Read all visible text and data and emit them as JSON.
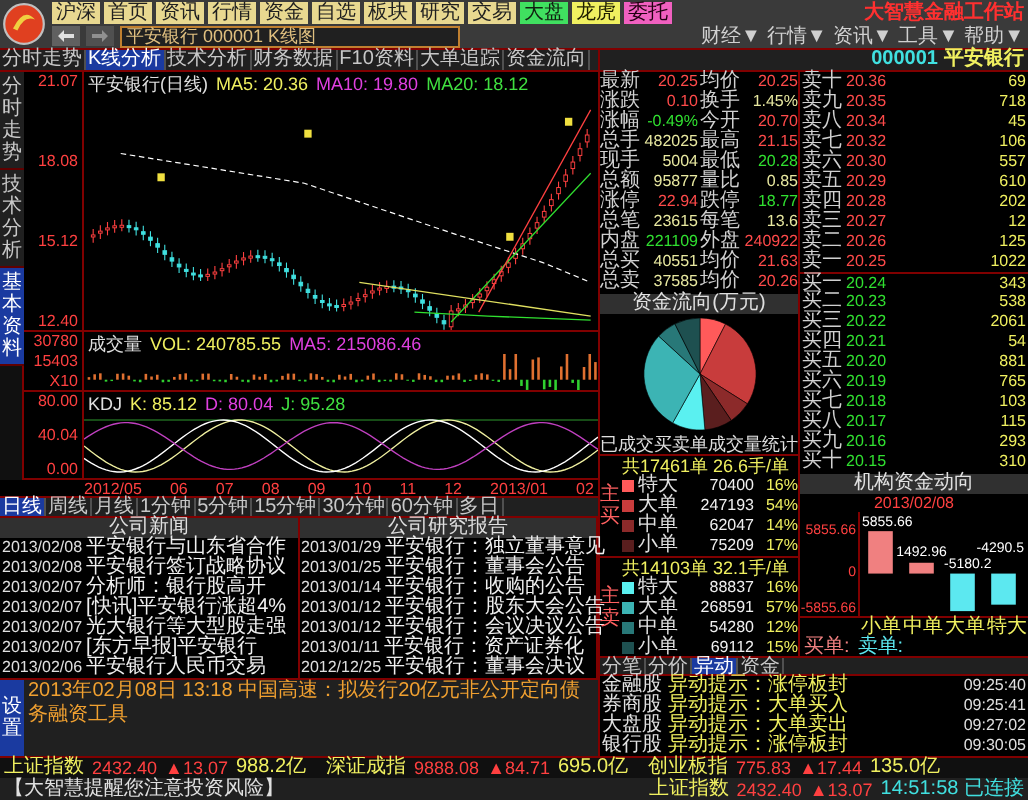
{
  "toolbar": {
    "buttons": [
      {
        "label": "沪深",
        "kind": "normal"
      },
      {
        "label": "首页",
        "kind": "normal"
      },
      {
        "label": "资讯",
        "kind": "normal"
      },
      {
        "label": "行情",
        "kind": "normal"
      },
      {
        "label": "资金",
        "kind": "normal"
      },
      {
        "label": "自选",
        "kind": "normal"
      },
      {
        "label": "板块",
        "kind": "normal"
      },
      {
        "label": "研究",
        "kind": "normal"
      },
      {
        "label": "交易",
        "kind": "normal"
      },
      {
        "label": "大盘",
        "kind": "green"
      },
      {
        "label": "龙虎",
        "kind": "yellow"
      },
      {
        "label": "委托",
        "kind": "pink"
      }
    ],
    "brand": "大智慧金融工作站",
    "address": "平安银行 000001 K线图",
    "menus": [
      "财经▼",
      "行情▼",
      "资讯▼",
      "工具▼",
      "帮助▼"
    ]
  },
  "chart_tabs": [
    {
      "label": "分时走势",
      "selected": false
    },
    {
      "label": "K线分析",
      "selected": true
    },
    {
      "label": "技术分析",
      "selected": false
    },
    {
      "label": "财务数据",
      "selected": false
    },
    {
      "label": "F10资料",
      "selected": false
    },
    {
      "label": "大单追踪",
      "selected": false
    },
    {
      "label": "资金流向",
      "selected": false
    }
  ],
  "side_tabs": [
    {
      "label": "分时走势",
      "selected": false
    },
    {
      "label": "技术分析",
      "selected": false
    },
    {
      "label": "基本资料",
      "selected": true
    }
  ],
  "price_chart": {
    "info": [
      "平安银行(日线)",
      "MA5: 20.36",
      "MA10: 19.80",
      "MA20: 18.12"
    ],
    "ticks": [
      "21.07",
      "18.08",
      "15.12",
      "12.40"
    ]
  },
  "volume_chart": {
    "info": [
      "成交量",
      "VOL: 240785.55",
      "MA5: 215086.46"
    ],
    "ticks": [
      "30780",
      "15403",
      "X10"
    ]
  },
  "oscillator": {
    "info": [
      "KDJ",
      "K: 85.12",
      "D: 80.04",
      "J: 95.28"
    ],
    "ticks": [
      "80.00",
      "40.04",
      "0.00"
    ]
  },
  "dates": [
    "2012/05",
    "06",
    "07",
    "08",
    "09",
    "10",
    "11",
    "12",
    "2013/01",
    "02"
  ],
  "period_tabs": [
    {
      "label": "日线",
      "selected": true
    },
    {
      "label": "周线",
      "selected": false
    },
    {
      "label": "月线",
      "selected": false
    },
    {
      "label": "1分钟",
      "selected": false
    },
    {
      "label": "5分钟",
      "selected": false
    },
    {
      "label": "15分钟",
      "selected": false
    },
    {
      "label": "30分钟",
      "selected": false
    },
    {
      "label": "60分钟",
      "selected": false
    },
    {
      "label": "多日",
      "selected": false
    }
  ],
  "news": [
    {
      "title": "公司新闻",
      "rows": [
        {
          "date": "2013/02/08",
          "title": "平安银行与山东省合作"
        },
        {
          "date": "2013/02/08",
          "title": "平安银行签订战略协议"
        },
        {
          "date": "2013/02/07",
          "title": "分析师：银行股高开"
        },
        {
          "date": "2013/02/07",
          "title": "[快讯]平安银行涨超4%"
        },
        {
          "date": "2013/02/07",
          "title": "光大银行等大型股走强"
        },
        {
          "date": "2013/02/07",
          "title": "[东方早报]平安银行"
        },
        {
          "date": "2013/02/06",
          "title": "平安银行人民币交易"
        }
      ]
    },
    {
      "title": "公司研究报告",
      "rows": [
        {
          "date": "2013/01/29",
          "title": "平安银行：独立董事意见"
        },
        {
          "date": "2013/01/25",
          "title": "平安银行：董事会公告"
        },
        {
          "date": "2013/01/14",
          "title": "平安银行：收购的公告"
        },
        {
          "date": "2013/01/12",
          "title": "平安银行：股东大会公告"
        },
        {
          "date": "2013/01/12",
          "title": "平安银行：会议决议公告"
        },
        {
          "date": "2013/01/11",
          "title": "平安银行：资产证券化"
        },
        {
          "date": "2012/12/25",
          "title": "平安银行：董事会决议"
        }
      ]
    }
  ],
  "ticker": {
    "button": "设置",
    "text": "2013年02月08日 13:18 中国高速：拟发行20亿元非公开定向债务融资工具"
  },
  "stock": {
    "code": "000001",
    "name": "平安银行"
  },
  "quote": [
    {
      "label": "最新",
      "value": "20.25",
      "kind": "up"
    },
    {
      "label": "均价",
      "value": "20.25",
      "kind": "up"
    },
    {
      "label": "涨跌",
      "value": "0.10",
      "kind": "up"
    },
    {
      "label": "换手",
      "value": "1.45%",
      "kind": "flat"
    },
    {
      "label": "涨幅",
      "value": "-0.49%",
      "kind": "down"
    },
    {
      "label": "今开",
      "value": "20.70",
      "kind": "up"
    },
    {
      "label": "总手",
      "value": "482025",
      "kind": "flat"
    },
    {
      "label": "最高",
      "value": "21.15",
      "kind": "up"
    },
    {
      "label": "现手",
      "value": "5004",
      "kind": "flat"
    },
    {
      "label": "最低",
      "value": "20.28",
      "kind": "down"
    },
    {
      "label": "总额",
      "value": "95877",
      "kind": "flat"
    },
    {
      "label": "量比",
      "value": "0.85",
      "kind": "flat"
    },
    {
      "label": "涨停",
      "value": "22.94",
      "kind": "up"
    },
    {
      "label": "跌停",
      "value": "18.77",
      "kind": "down"
    },
    {
      "label": "总笔",
      "value": "23615",
      "kind": "flat"
    },
    {
      "label": "每笔",
      "value": "13.6",
      "kind": "flat"
    },
    {
      "label": "内盘",
      "value": "221109",
      "kind": "down"
    },
    {
      "label": "外盘",
      "value": "240922",
      "kind": "up"
    },
    {
      "label": "总买",
      "value": "40551",
      "kind": "flat"
    },
    {
      "label": "均价",
      "value": "21.63",
      "kind": "up"
    },
    {
      "label": "总卖",
      "value": "37585",
      "kind": "flat"
    },
    {
      "label": "均价",
      "value": "20.26",
      "kind": "up"
    }
  ],
  "levels": [
    {
      "label": "卖十",
      "price": "20.36",
      "volume": "69",
      "kind": "up"
    },
    {
      "label": "卖九",
      "price": "20.35",
      "volume": "718",
      "kind": "up"
    },
    {
      "label": "卖八",
      "price": "20.34",
      "volume": "45",
      "kind": "up"
    },
    {
      "label": "卖七",
      "price": "20.32",
      "volume": "106",
      "kind": "up"
    },
    {
      "label": "卖六",
      "price": "20.30",
      "volume": "557",
      "kind": "up"
    },
    {
      "label": "卖五",
      "price": "20.29",
      "volume": "610",
      "kind": "up"
    },
    {
      "label": "卖四",
      "price": "20.28",
      "volume": "202",
      "kind": "up"
    },
    {
      "label": "卖三",
      "price": "20.27",
      "volume": "12",
      "kind": "up"
    },
    {
      "label": "卖二",
      "price": "20.26",
      "volume": "125",
      "kind": "up"
    },
    {
      "label": "卖一",
      "price": "20.25",
      "volume": "1022",
      "kind": "up"
    },
    {
      "label": "买一",
      "price": "20.24",
      "volume": "343",
      "kind": "down"
    },
    {
      "label": "买二",
      "price": "20.23",
      "volume": "538",
      "kind": "down"
    },
    {
      "label": "买三",
      "price": "20.22",
      "volume": "2061",
      "kind": "down"
    },
    {
      "label": "买四",
      "price": "20.21",
      "volume": "54",
      "kind": "down"
    },
    {
      "label": "买五",
      "price": "20.20",
      "volume": "881",
      "kind": "down"
    },
    {
      "label": "买六",
      "price": "20.19",
      "volume": "765",
      "kind": "down"
    },
    {
      "label": "买七",
      "price": "20.18",
      "volume": "103",
      "kind": "down"
    },
    {
      "label": "买八",
      "price": "20.17",
      "volume": "115",
      "kind": "down"
    },
    {
      "label": "买九",
      "price": "20.16",
      "volume": "293",
      "kind": "down"
    },
    {
      "label": "买十",
      "price": "20.15",
      "volume": "310",
      "kind": "down"
    }
  ],
  "flow": {
    "title": "资金流向(万元)",
    "legend_title": "已成交买卖单成交量统计",
    "groups": [
      {
        "header": "共17461单 26.6手/单",
        "side": "主买",
        "items": [
          {
            "label": "特大",
            "amount": "70400",
            "share": "16%",
            "color": "#ff5a5a"
          },
          {
            "label": "大单",
            "amount": "247193",
            "share": "54%",
            "color": "#c83c3c"
          },
          {
            "label": "中单",
            "amount": "62047",
            "share": "14%",
            "color": "#8c2a2a"
          },
          {
            "label": "小单",
            "amount": "75209",
            "share": "17%",
            "color": "#5a1e1e"
          }
        ]
      },
      {
        "header": "共14103单 32.1手/单",
        "side": "主卖",
        "items": [
          {
            "label": "特大",
            "amount": "88837",
            "share": "16%",
            "color": "#5af0f0"
          },
          {
            "label": "大单",
            "amount": "268591",
            "share": "57%",
            "color": "#3cb4b4"
          },
          {
            "label": "中单",
            "amount": "54280",
            "share": "12%",
            "color": "#287878"
          },
          {
            "label": "小单",
            "amount": "69112",
            "share": "15%",
            "color": "#1e5050"
          }
        ]
      }
    ]
  },
  "compare": {
    "title": "机构资金动向",
    "date": "2013/02/08",
    "chart_data": {
      "type": "bar",
      "categories": [
        "小单",
        "中单",
        "大单",
        "特大"
      ],
      "series": [
        {
          "name": "买单:",
          "color": "#f08080",
          "values": [
            5855.66,
            1492.96,
            null,
            null
          ]
        },
        {
          "name": "卖单:",
          "color": "#5ce8f0",
          "values": [
            null,
            null,
            -5180.2,
            -4290.5
          ]
        }
      ],
      "ylim": [
        -5855.66,
        8500
      ],
      "yticks": [
        -5855.66,
        0,
        5855.66
      ],
      "data_labels": true
    }
  },
  "detail_tabs": [
    {
      "label": "分笔",
      "selected": false
    },
    {
      "label": "分价",
      "selected": false
    },
    {
      "label": "异动",
      "selected": true
    },
    {
      "label": "资金",
      "selected": false
    }
  ],
  "alerts": [
    {
      "name": "金融股",
      "event": "异动提示：涨停板封",
      "time": "09:25:40"
    },
    {
      "name": "券商股",
      "event": "异动提示：大单买入",
      "time": "09:25:41"
    },
    {
      "name": "大盘股",
      "event": "异动提示：大单卖出",
      "time": "09:27:02"
    },
    {
      "name": "银行股",
      "event": "异动提示：涨停板封",
      "time": "09:30:05"
    }
  ],
  "indices": [
    {
      "name": "上证指数",
      "value": "2432.40",
      "change": "▲13.07",
      "turnover": "988.2亿"
    },
    {
      "name": "深证成指",
      "value": "9888.08",
      "change": "▲84.71",
      "turnover": "695.0亿"
    },
    {
      "name": "创业板指",
      "value": "775.83",
      "change": "▲17.44",
      "turnover": "135.0亿"
    }
  ],
  "footer": {
    "note": "【大智慧提醒您注意投资风险】",
    "index": {
      "name": "上证指数",
      "value": "2432.40",
      "change": "▲13.07"
    },
    "status": "14:51:58 已连接"
  }
}
